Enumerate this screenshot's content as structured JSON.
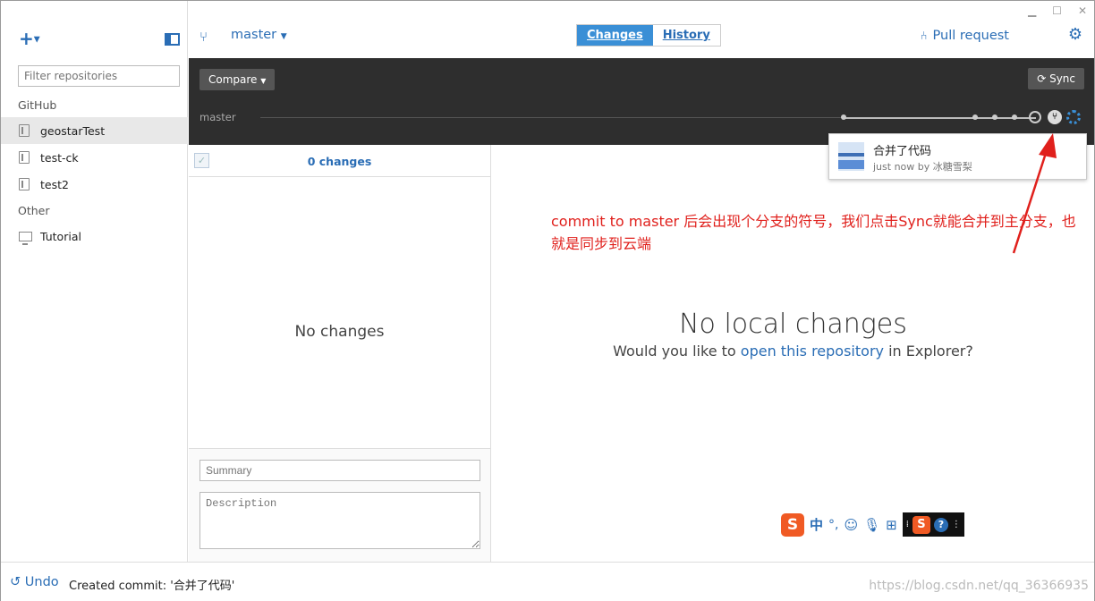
{
  "window": {
    "minimize": "▁",
    "maximize": "☐",
    "close": "✕"
  },
  "sidebar": {
    "add_label": "+",
    "filter_placeholder": "Filter repositories",
    "sections": [
      {
        "title": "GitHub"
      },
      {
        "title": "Other"
      }
    ],
    "github_repos": [
      "geostarTest",
      "test-ck",
      "test2"
    ],
    "other_repos": [
      "Tutorial"
    ]
  },
  "header": {
    "branch": "master",
    "tabs": [
      {
        "label": "Changes",
        "active": true
      },
      {
        "label": "History",
        "active": false
      }
    ],
    "pull_request": "Pull request"
  },
  "toolbar": {
    "compare": "Compare",
    "sync": "Sync",
    "branch_label": "master"
  },
  "popup": {
    "title": "合并了代码",
    "subtitle": "just now by 冰糖雪梨"
  },
  "changes": {
    "count": "0 changes",
    "empty": "No changes",
    "summary_placeholder": "Summary",
    "description_placeholder": "Description"
  },
  "main": {
    "title": "No local changes",
    "sub_before": "Would you like to ",
    "sub_link": "open this repository",
    "sub_after": " in Explorer?"
  },
  "annotation": {
    "text": "commit to master 后会出现个分支的符号，我们点击Sync就能合并到主分支，也就是同步到云端"
  },
  "ime": {
    "logo": "S",
    "mode": "中",
    "punct": "°,",
    "help": "?"
  },
  "status": {
    "undo": "Undo",
    "message": "Created commit: '合并了代码'",
    "watermark": "https://blog.csdn.net/qq_36366935"
  },
  "colors": {
    "accent": "#2a6db5",
    "active_tab": "#3a8fd6",
    "dark_bar": "#2e2e2e",
    "annotation": "#e0201c"
  }
}
